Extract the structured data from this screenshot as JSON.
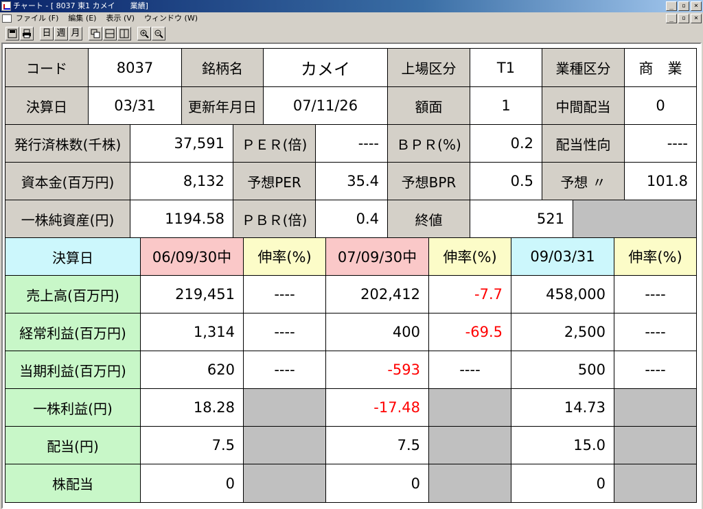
{
  "window": {
    "title": "チャート - [ 8037 東1 カメイ　　業績]"
  },
  "menu": {
    "items": [
      "ファイル (F)",
      "編集 (E)",
      "表示 (V)",
      "ウィンドウ (W)"
    ]
  },
  "toolbar": {
    "day": "日",
    "week": "週",
    "month": "月"
  },
  "info": {
    "code_label": "コード",
    "code": "8037",
    "name_label": "銘柄名",
    "name": "カメイ",
    "market_label": "上場区分",
    "market": "T1",
    "industry_label": "業種区分",
    "industry": "商　業",
    "fiscal_label": "決算日",
    "fiscal": "03/31",
    "updated_label": "更新年月日",
    "updated": "07/11/26",
    "par_label": "額面",
    "par": "1",
    "interim_label": "中間配当",
    "interim": "0",
    "shares_label": "発行済株数(千株)",
    "shares": "37,591",
    "per_label": "ＰＥＲ(倍)",
    "per": "----",
    "bpr_label": "ＢＰＲ(%)",
    "bpr": "0.2",
    "payout_label": "配当性向",
    "payout": "----",
    "capital_label": "資本金(百万円)",
    "capital": "8,132",
    "fper_label": "予想PER",
    "fper": "35.4",
    "fbpr_label": "予想BPR",
    "fbpr": "0.5",
    "fpayout_label": "予想 〃",
    "fpayout": "101.8",
    "bps_label": "一株純資産(円)",
    "bps": "1194.58",
    "pbr_label": "ＰＢＲ(倍)",
    "pbr": "0.4",
    "close_label": "終値",
    "close": "521"
  },
  "results": {
    "header": {
      "label": "決算日",
      "p1": "06/09/30中",
      "g1": "伸率(%)",
      "p2": "07/09/30中",
      "g2": "伸率(%)",
      "p3": "09/03/31",
      "g3": "伸率(%)"
    },
    "rows": [
      {
        "label": "売上高(百万円)",
        "v1": "219,451",
        "g1": "----",
        "v2": "202,412",
        "g2": "-7.7",
        "v3": "458,000",
        "g3": "----"
      },
      {
        "label": "経常利益(百万円)",
        "v1": "1,314",
        "g1": "----",
        "v2": "400",
        "g2": "-69.5",
        "v3": "2,500",
        "g3": "----"
      },
      {
        "label": "当期利益(百万円)",
        "v1": "620",
        "g1": "----",
        "v2": "-593",
        "g2": "----",
        "v3": "500",
        "g3": "----"
      },
      {
        "label": "一株利益(円)",
        "v1": "18.28",
        "v2": "-17.48",
        "v3": "14.73"
      },
      {
        "label": "配当(円)",
        "v1": "7.5",
        "v2": "7.5",
        "v3": "15.0"
      },
      {
        "label": "株配当",
        "v1": "0",
        "v2": "0",
        "v3": "0"
      }
    ]
  }
}
